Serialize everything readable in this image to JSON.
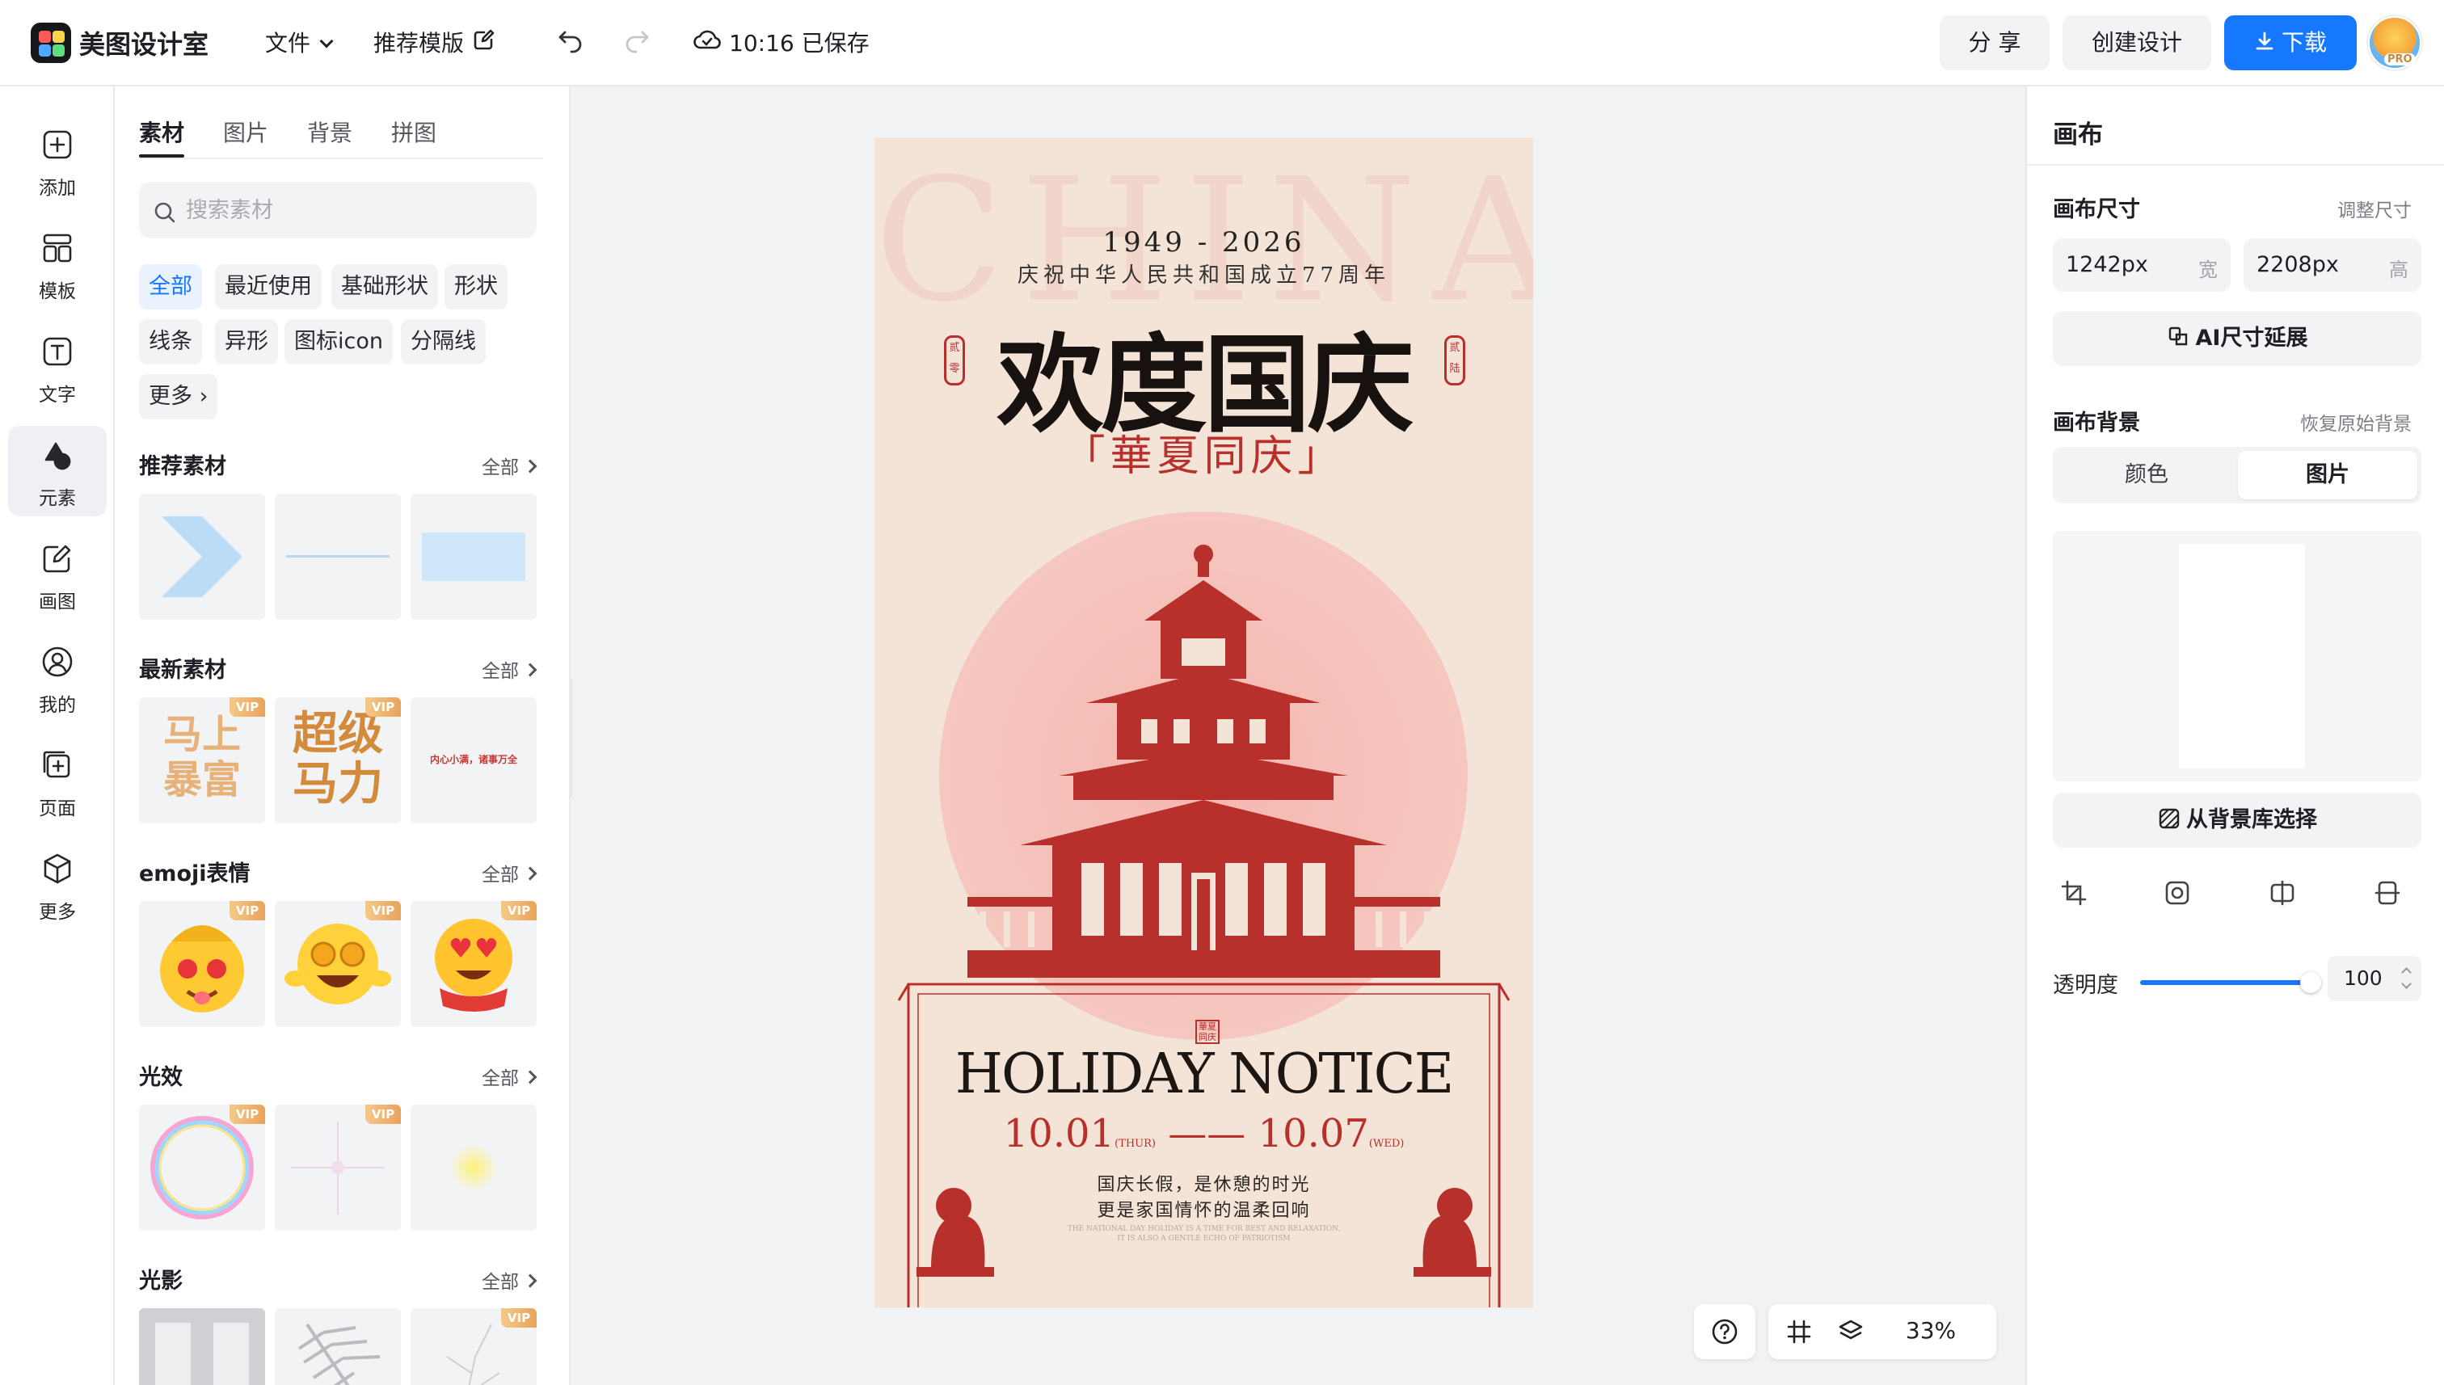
{
  "header": {
    "app_name": "美图设计室",
    "file_menu": "文件",
    "template_recommend": "推荐模版",
    "save_status": "10:16 已保存",
    "share": "分 享",
    "create_design": "创建设计",
    "download": "下载",
    "pro_badge": "PRO"
  },
  "rail": {
    "items": [
      {
        "label": "添加",
        "icon": "plus-square-icon"
      },
      {
        "label": "模板",
        "icon": "template-grid-icon"
      },
      {
        "label": "文字",
        "icon": "text-icon"
      },
      {
        "label": "元素",
        "icon": "shapes-icon"
      },
      {
        "label": "画图",
        "icon": "draw-icon"
      },
      {
        "label": "我的",
        "icon": "user-icon"
      },
      {
        "label": "页面",
        "icon": "page-add-icon"
      },
      {
        "label": "更多",
        "icon": "box-icon"
      }
    ],
    "active": "元素"
  },
  "library": {
    "tabs": [
      "素材",
      "图片",
      "背景",
      "拼图"
    ],
    "active_tab": "素材",
    "search_placeholder": "搜索素材",
    "chips": [
      "全部",
      "最近使用",
      "基础形状",
      "形状",
      "线条",
      "异形",
      "图标icon",
      "分隔线",
      "更多"
    ],
    "active_chip": "全部",
    "all_label": "全部",
    "vip_label": "VIP",
    "sections": [
      {
        "title": "推荐素材"
      },
      {
        "title": "最新素材",
        "thumbs": [
          "马上\n暴富",
          "超级\n马力",
          "内心小满，诸事万全"
        ]
      },
      {
        "title": "emoji表情"
      },
      {
        "title": "光效"
      },
      {
        "title": "光影"
      }
    ]
  },
  "poster": {
    "bg_word": "CHINA",
    "years": "1949 - 2026",
    "anniversary": "庆祝中华人民共和国成立77周年",
    "headline": "欢度国庆",
    "subheadline": "「華夏同庆」",
    "seal_left": "贰零",
    "seal_right": "贰陆",
    "stamp": "華夏\n同庆",
    "holiday": "HOLIDAY NOTICE",
    "date_start": "10.01",
    "date_start_day": "(THUR)",
    "date_end": "10.07",
    "date_end_day": "(WED)",
    "line1": "国庆长假，是休憩的时光",
    "line2": "更是家国情怀的温柔回响",
    "fine1": "THE NATIONAL DAY HOLIDAY IS A TIME FOR REST AND RELAXATION,",
    "fine2": "IT IS ALSO A GENTLE ECHO OF PATRIOTISM",
    "accent_color": "#b8302c"
  },
  "canvas_tools": {
    "zoom": "33%"
  },
  "right_panel": {
    "title": "画布",
    "size_label": "画布尺寸",
    "resize_link": "调整尺寸",
    "width_value": "1242px",
    "width_unit": "宽",
    "height_value": "2208px",
    "height_unit": "高",
    "ai_extend": "AI尺寸延展",
    "bg_label": "画布背景",
    "restore_bg": "恢复原始背景",
    "bg_tabs": [
      "颜色",
      "图片"
    ],
    "bg_active": "图片",
    "bg_library": "从背景库选择",
    "opacity_label": "透明度",
    "opacity_value": "100",
    "opacity_fraction": 1.0
  },
  "colors": {
    "brand_blue": "#1677ff",
    "poster_red": "#b8302c"
  }
}
